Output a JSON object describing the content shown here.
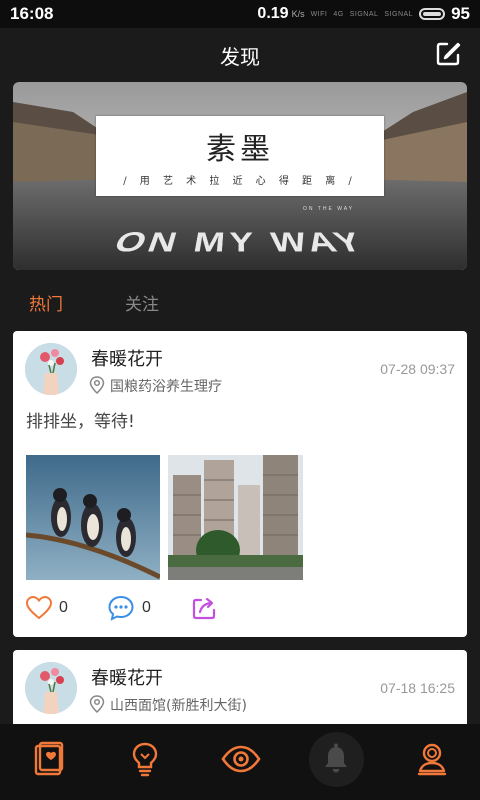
{
  "status_bar": {
    "time": "16:08",
    "net_speed": "0.19",
    "net_unit": "K/s",
    "wifi_label": "WIFI",
    "signal_label_1": "4G",
    "signal_label_2": "SIGNAL",
    "signal_label_3": "SIGNAL",
    "battery": "95"
  },
  "header": {
    "title": "发现",
    "edit_icon": "edit-icon"
  },
  "banner": {
    "title": "素墨",
    "subtitle": "/ 用 艺 术 拉 近 心 得 距 离 /",
    "small_text": "ON THE WAY",
    "road_text": "ON MY WAY"
  },
  "tabs": [
    {
      "label": "热门",
      "active": true
    },
    {
      "label": "关注",
      "active": false
    }
  ],
  "posts": [
    {
      "user": "春暖花开",
      "location": "国粮药浴养生理疗",
      "time": "07-28 09:37",
      "text": "排排坐，等待!",
      "likes": "0",
      "comments": "0"
    },
    {
      "user": "春暖花开",
      "location": "山西面馆(新胜利大街)",
      "time": "07-18 16:25"
    }
  ],
  "bottom_nav": [
    {
      "icon": "book-icon"
    },
    {
      "icon": "lightbulb-icon"
    },
    {
      "icon": "eye-icon"
    },
    {
      "icon": "bell-icon"
    },
    {
      "icon": "profile-icon"
    }
  ],
  "colors": {
    "accent": "#f07838",
    "background": "#1b1b1b",
    "card": "#ffffff",
    "comment_blue": "#3a8ee6",
    "share_purple": "#c34fe0"
  }
}
